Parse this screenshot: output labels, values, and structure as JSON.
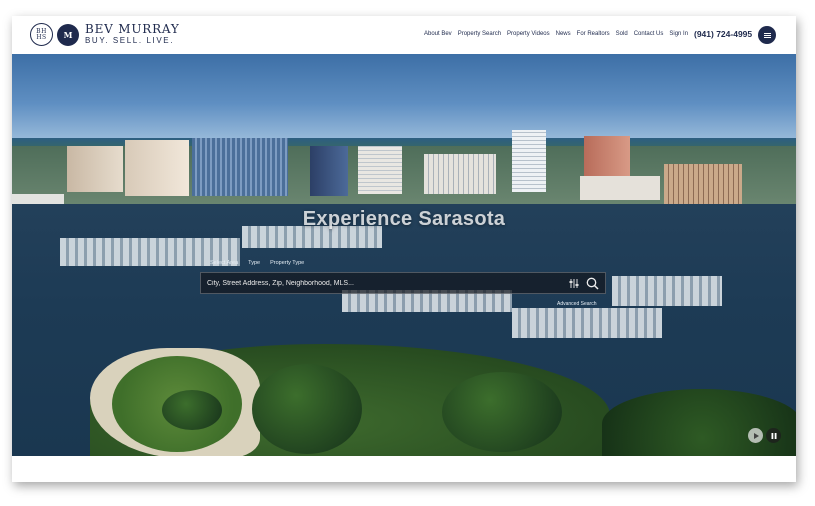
{
  "header": {
    "logo_badge_line1": "BH",
    "logo_badge_line2": "HS",
    "logo_monogram": "M",
    "brand_name": "BEV MURRAY",
    "brand_tagline": "BUY. SELL. LIVE.",
    "nav": [
      {
        "label": "About Bev"
      },
      {
        "label": "Property Search"
      },
      {
        "label": "Property Videos"
      },
      {
        "label": "News"
      },
      {
        "label": "For Realtors"
      },
      {
        "label": "Sold"
      },
      {
        "label": "Contact Us"
      },
      {
        "label": "Sign In"
      }
    ],
    "phone": "(941) 724-4995",
    "menu_icon": "hamburger-menu-icon"
  },
  "hero": {
    "title": "Experience Sarasota",
    "search_tabs": [
      "Select Area",
      "Type",
      "Property Type"
    ],
    "search_placeholder": "City, Street Address, Zip, Neighborhood, MLS...",
    "advanced_label": "Advanced Search"
  },
  "colors": {
    "brand_navy": "#1f2a4d",
    "search_bar_bg": "rgba(20,24,30,0.72)"
  }
}
